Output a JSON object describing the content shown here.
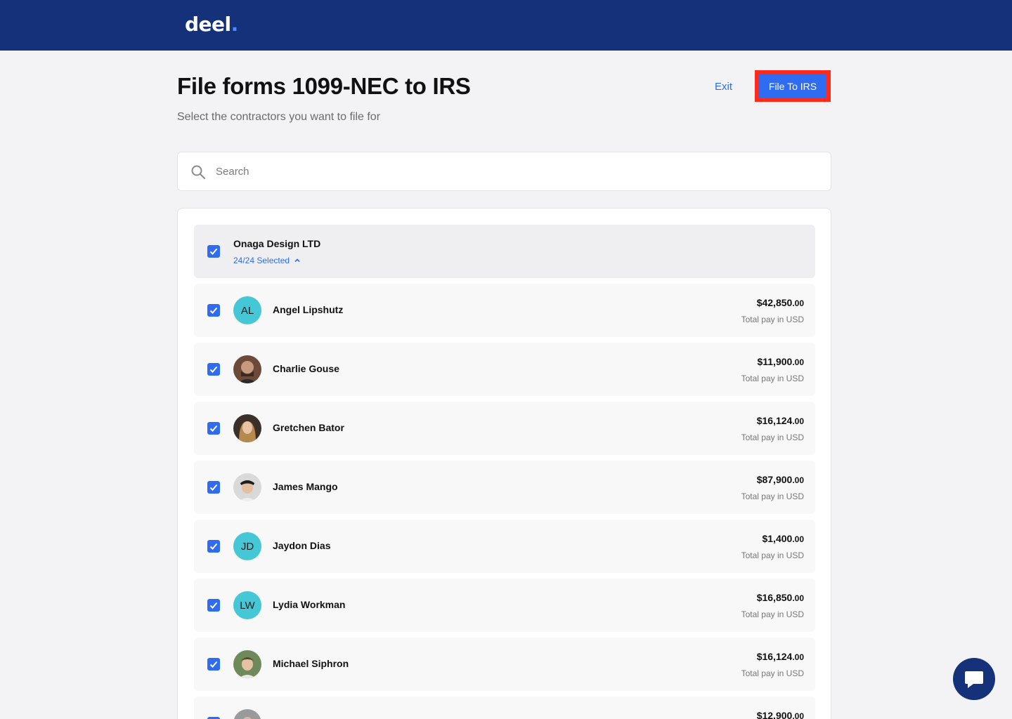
{
  "brand": {
    "name": "deel",
    "dot": "."
  },
  "header": {
    "title": "File forms 1099-NEC to IRS",
    "subtitle": "Select the contractors you want to file for",
    "exit_label": "Exit",
    "file_label": "File To IRS"
  },
  "search": {
    "placeholder": "Search"
  },
  "group": {
    "name": "Onaga Design LTD",
    "selected_text": "24/24 Selected"
  },
  "contractors": [
    {
      "name": "Angel Lipshutz",
      "initials": "AL",
      "avatar": "initials",
      "amount": "$42,850",
      "cents": ".00",
      "label": "Total pay in USD"
    },
    {
      "name": "Charlie Gouse",
      "initials": "",
      "avatar": "photo",
      "amount": "$11,900",
      "cents": ".00",
      "label": "Total pay in USD"
    },
    {
      "name": "Gretchen Bator",
      "initials": "",
      "avatar": "photo",
      "amount": "$16,124",
      "cents": ".00",
      "label": "Total pay in USD"
    },
    {
      "name": "James Mango",
      "initials": "",
      "avatar": "photo",
      "amount": "$87,900",
      "cents": ".00",
      "label": "Total pay in USD"
    },
    {
      "name": "Jaydon Dias",
      "initials": "JD",
      "avatar": "initials",
      "amount": "$1,400",
      "cents": ".00",
      "label": "Total pay in USD"
    },
    {
      "name": "Lydia Workman",
      "initials": "LW",
      "avatar": "initials",
      "amount": "$16,850",
      "cents": ".00",
      "label": "Total pay in USD"
    },
    {
      "name": "Michael Siphron",
      "initials": "",
      "avatar": "photo",
      "amount": "$16,124",
      "cents": ".00",
      "label": "Total pay in USD"
    },
    {
      "name": "",
      "initials": "",
      "avatar": "photo",
      "amount": "$12,900",
      "cents": ".00",
      "label": ""
    }
  ],
  "colors": {
    "brand_navy": "#15317a",
    "accent_blue": "#2f6cf2",
    "highlight_red": "#ff2a1a",
    "avatar_teal": "#45c7d6"
  },
  "icons": {
    "search": "search-icon",
    "check": "checkmark-icon",
    "chevron": "chevron-up-icon",
    "chat": "chat-bubble-icon"
  }
}
